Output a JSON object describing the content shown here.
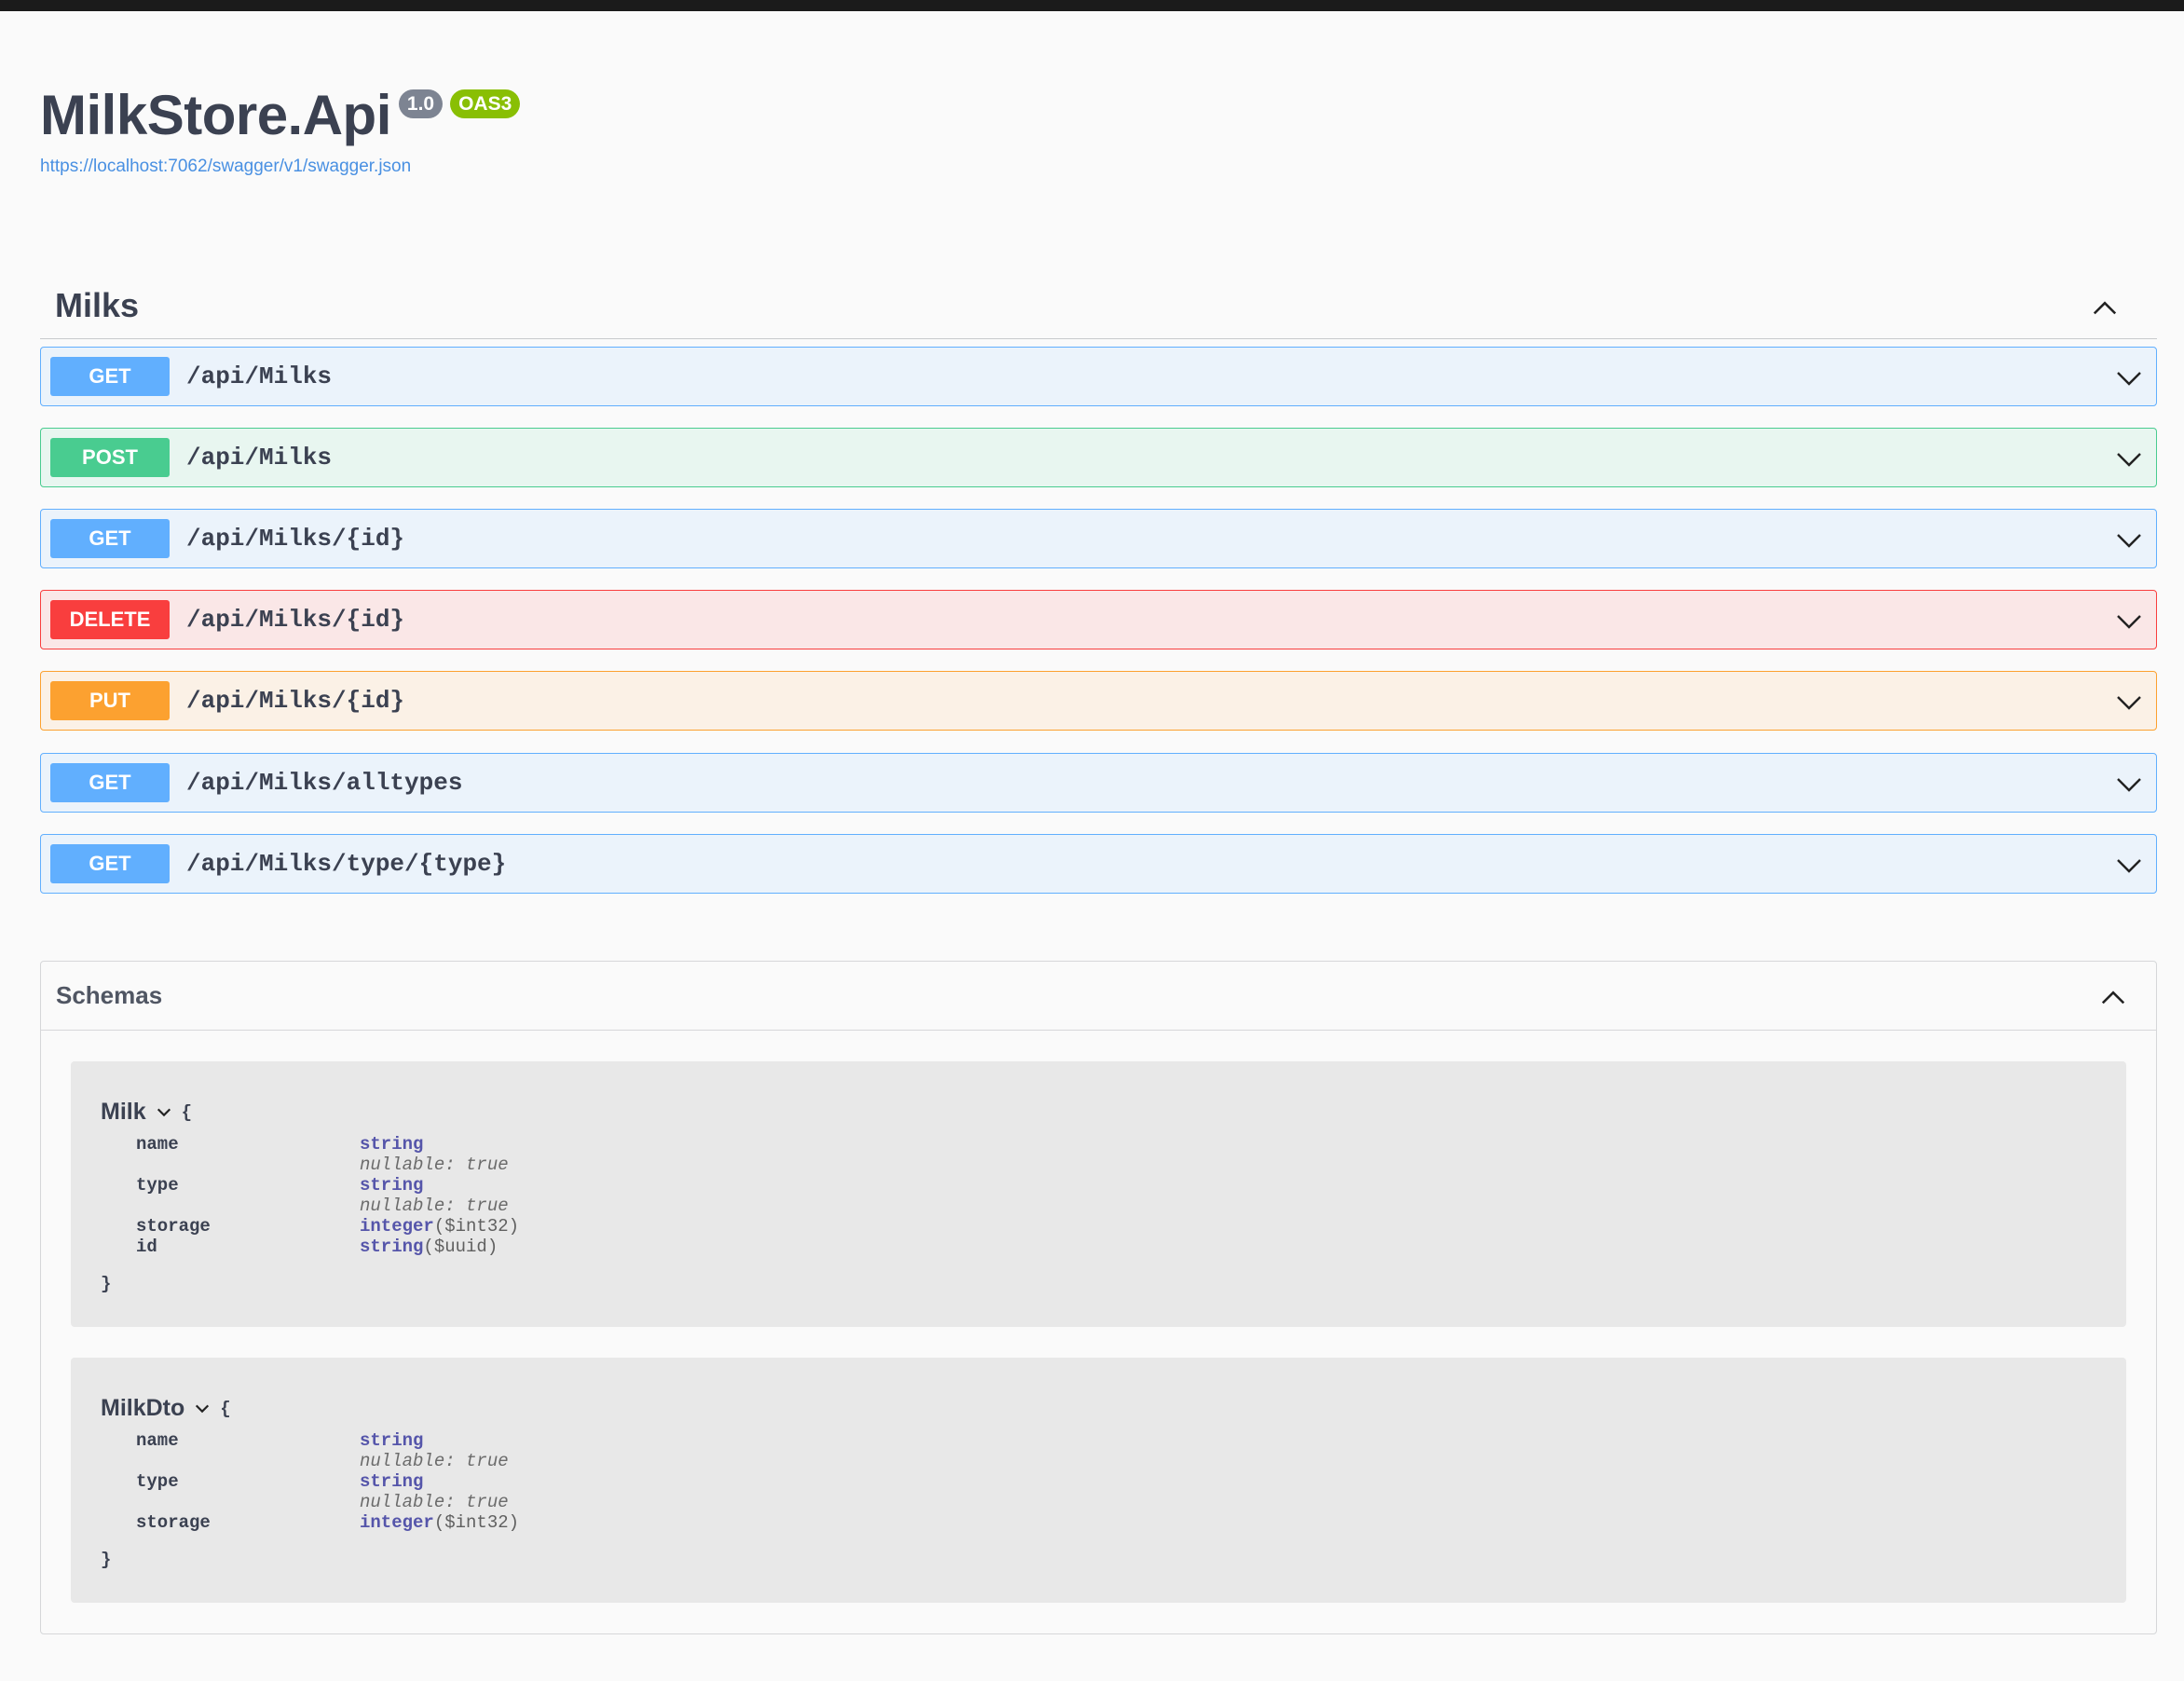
{
  "info": {
    "title": "MilkStore.Api",
    "version": "1.0",
    "oas": "OAS3",
    "spec_url": "https://localhost:7062/swagger/v1/swagger.json"
  },
  "tag": {
    "name": "Milks",
    "operations": [
      {
        "method": "GET",
        "path": "/api/Milks"
      },
      {
        "method": "POST",
        "path": "/api/Milks"
      },
      {
        "method": "GET",
        "path": "/api/Milks/{id}"
      },
      {
        "method": "DELETE",
        "path": "/api/Milks/{id}"
      },
      {
        "method": "PUT",
        "path": "/api/Milks/{id}"
      },
      {
        "method": "GET",
        "path": "/api/Milks/alltypes"
      },
      {
        "method": "GET",
        "path": "/api/Milks/type/{type}"
      }
    ]
  },
  "schemas": {
    "title": "Schemas",
    "models": [
      {
        "name": "Milk",
        "open_brace": "{",
        "close_brace": "}",
        "properties": [
          {
            "name": "name",
            "type": "string",
            "format": "",
            "nullable": "nullable: true"
          },
          {
            "name": "type",
            "type": "string",
            "format": "",
            "nullable": "nullable: true"
          },
          {
            "name": "storage",
            "type": "integer",
            "format": "($int32)",
            "nullable": ""
          },
          {
            "name": "id",
            "type": "string",
            "format": "($uuid)",
            "nullable": ""
          }
        ]
      },
      {
        "name": "MilkDto",
        "open_brace": "{",
        "close_brace": "}",
        "properties": [
          {
            "name": "name",
            "type": "string",
            "format": "",
            "nullable": "nullable: true"
          },
          {
            "name": "type",
            "type": "string",
            "format": "",
            "nullable": "nullable: true"
          },
          {
            "name": "storage",
            "type": "integer",
            "format": "($int32)",
            "nullable": ""
          }
        ]
      }
    ]
  },
  "colors": {
    "get": "#61affe",
    "post": "#49cc90",
    "delete": "#f93e3e",
    "put": "#fca130"
  },
  "icons": {
    "collapse": "chevron-up-icon",
    "expand": "chevron-down-icon"
  }
}
